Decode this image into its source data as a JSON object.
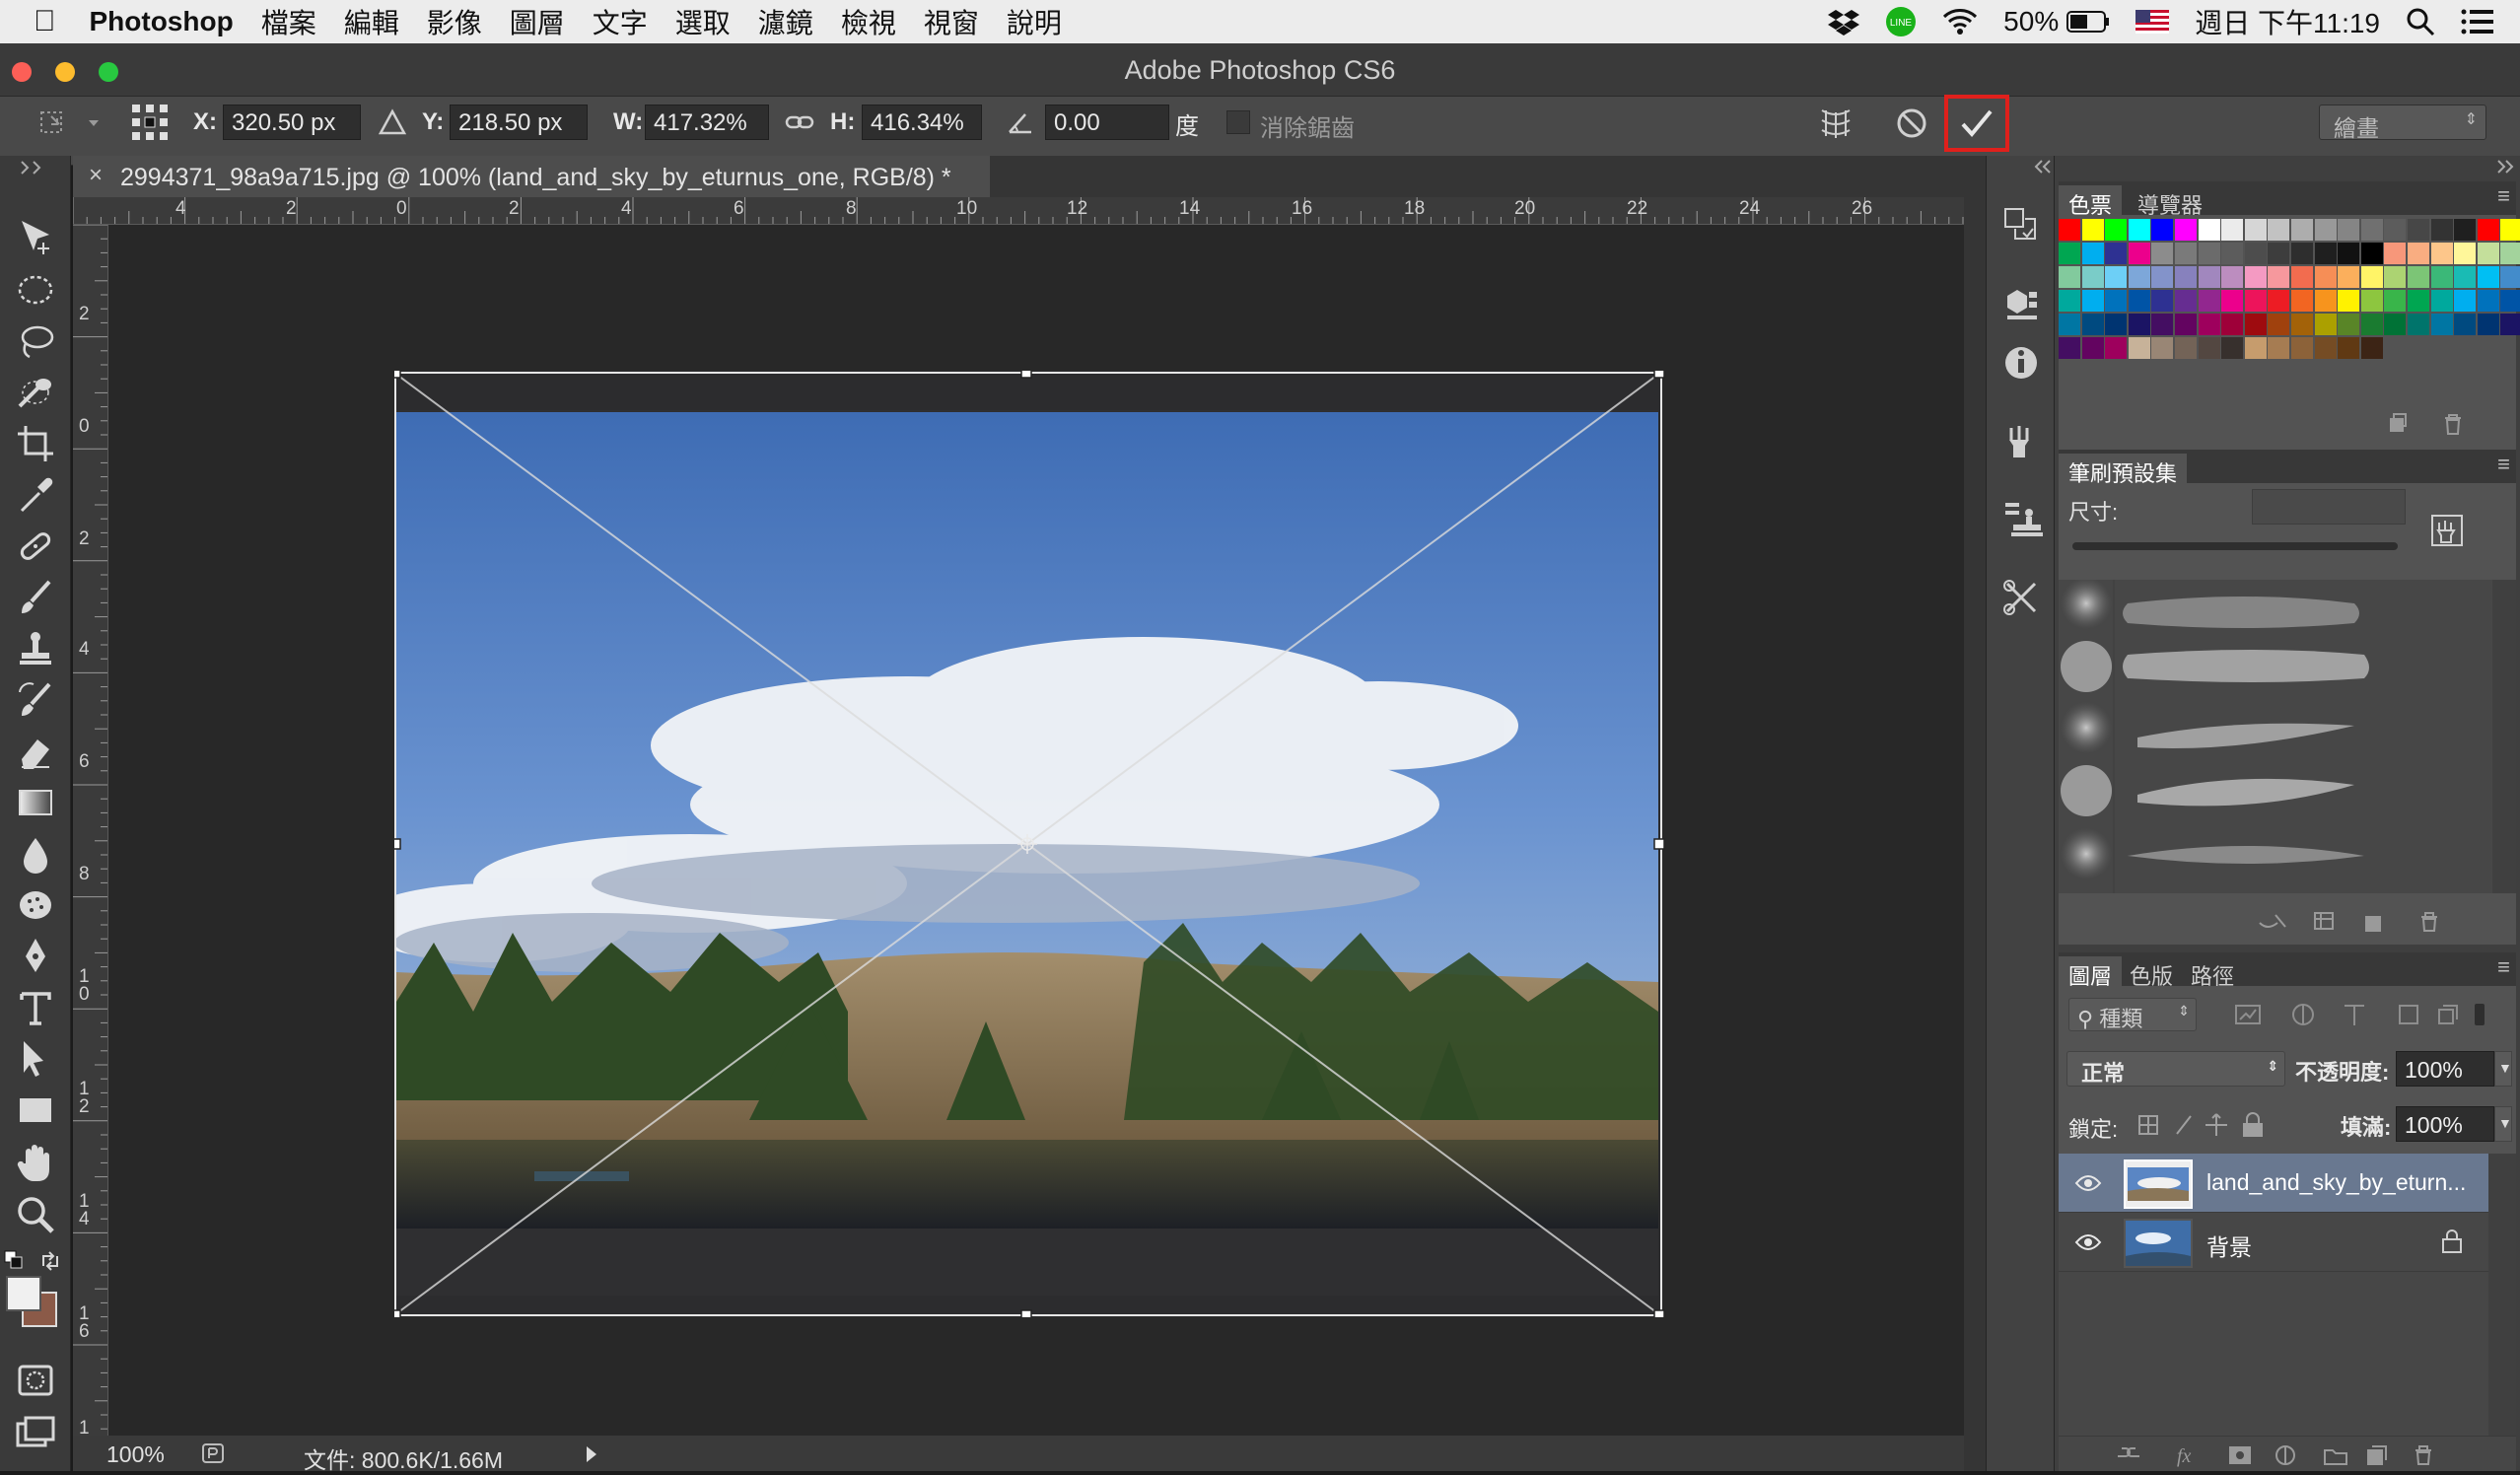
{
  "menubar": {
    "app_name": "Photoshop",
    "menus": [
      "檔案",
      "編輯",
      "影像",
      "圖層",
      "文字",
      "選取",
      "濾鏡",
      "檢視",
      "視窗",
      "說明"
    ],
    "battery": "50%",
    "clock": "週日 下午11:19"
  },
  "window": {
    "title": "Adobe Photoshop CS6"
  },
  "options": {
    "x_label": "X:",
    "x_value": "320.50 px",
    "y_label": "Y:",
    "y_value": "218.50 px",
    "w_label": "W:",
    "w_value": "417.32%",
    "h_label": "H:",
    "h_value": "416.34%",
    "angle_value": "0.00",
    "angle_unit": "度",
    "antialias_label": "消除鋸齒",
    "workspace": "繪畫",
    "commit_highlight_color": "#e0201c"
  },
  "document": {
    "tab_title": "2994371_98a9a715.jpg @ 100% (land_and_sky_by_eturnus_one, RGB/8) *",
    "zoom": "100%",
    "doc_size": "文件: 800.6K/1.66M"
  },
  "rulers": {
    "h_ticks": [
      "4",
      "2",
      "0",
      "2",
      "4",
      "6",
      "8",
      "10",
      "12",
      "14",
      "16",
      "18",
      "20",
      "22",
      "24",
      "26"
    ],
    "v_ticks": [
      "2",
      "0",
      "2",
      "4",
      "6",
      "8",
      "1\n0",
      "1\n2",
      "1\n4",
      "1\n6",
      "1"
    ]
  },
  "panels": {
    "swatches_tabs": [
      "色票",
      "導覽器"
    ],
    "brush_tab": "筆刷預設集",
    "brush_size_label": "尺寸:",
    "layers_tabs": [
      "圖層",
      "色版",
      "路徑"
    ],
    "filter_kind": "種類",
    "blend_mode": "正常",
    "opacity_label": "不透明度:",
    "opacity_value": "100%",
    "lock_label": "鎖定:",
    "fill_label": "填滿:",
    "fill_value": "100%",
    "layers": [
      {
        "name": "land_and_sky_by_eturn...",
        "selected": true
      },
      {
        "name": "背景",
        "selected": false
      }
    ]
  }
}
